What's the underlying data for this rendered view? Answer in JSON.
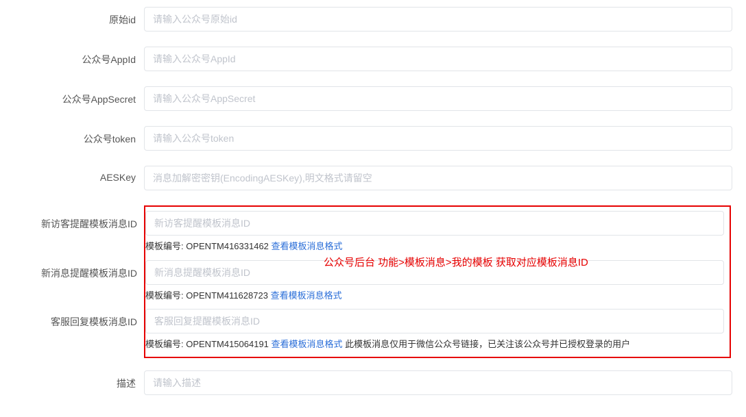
{
  "fields": {
    "original_id": {
      "label": "原始id",
      "placeholder": "请输入公众号原始id"
    },
    "app_id": {
      "label": "公众号AppId",
      "placeholder": "请输入公众号AppId"
    },
    "app_secret": {
      "label": "公众号AppSecret",
      "placeholder": "请输入公众号AppSecret"
    },
    "token": {
      "label": "公众号token",
      "placeholder": "请输入公众号token"
    },
    "aes_key": {
      "label": "AESKey",
      "placeholder": "消息加解密密钥(EncodingAESKey),明文格式请留空"
    },
    "new_visitor_tmpl": {
      "label": "新访客提醒模板消息ID",
      "placeholder": "新访客提醒模板消息ID",
      "help_prefix": "模板编号: OPENTM416331462 ",
      "help_link": "查看模板消息格式"
    },
    "new_message_tmpl": {
      "label": "新消息提醒模板消息ID",
      "placeholder": "新消息提醒模板消息ID",
      "help_prefix": "模板编号: OPENTM411628723 ",
      "help_link": "查看模板消息格式"
    },
    "cs_reply_tmpl": {
      "label": "客服回复模板消息ID",
      "placeholder": "客服回复提醒模板消息ID",
      "help_prefix": "模板编号: OPENTM415064191 ",
      "help_link": "查看模板消息格式",
      "help_suffix": " 此模板消息仅用于微信公众号链接，已关注该公众号并已授权登录的用户"
    },
    "description": {
      "label": "描述",
      "placeholder": "请输入描述"
    }
  },
  "overlay_note": "公众号后台  功能>模板消息>我的模板  获取对应模板消息ID"
}
